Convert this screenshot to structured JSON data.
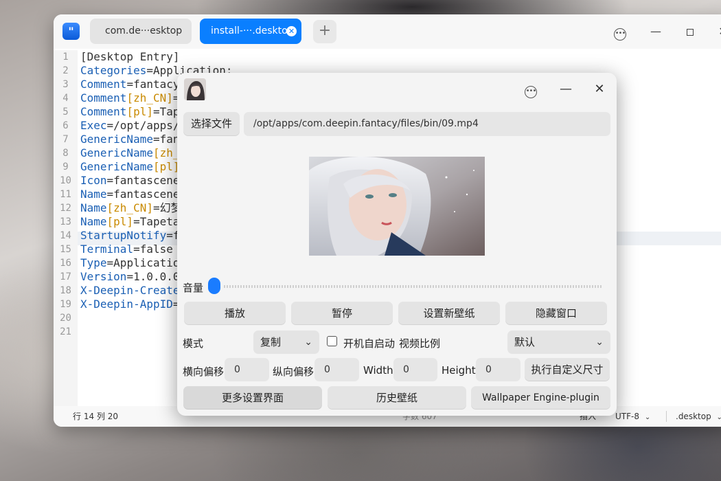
{
  "editor": {
    "tabs": [
      {
        "label": "com.de···esktop"
      },
      {
        "label": "install-···.deskto"
      }
    ],
    "tab_add_label": "+",
    "line_numbers": [
      "1",
      "2",
      "3",
      "4",
      "5",
      "6",
      "7",
      "8",
      "9",
      "10",
      "11",
      "12",
      "13",
      "14",
      "15",
      "16",
      "17",
      "18",
      "19",
      "20",
      "21"
    ],
    "lines": [
      {
        "plain": "[Desktop Entry]"
      },
      {
        "key": "Categories",
        "val": "Application;"
      },
      {
        "key": "Comment",
        "val": "fantacy"
      },
      {
        "key": "Comment",
        "loc": "[zh_CN]",
        "val": ""
      },
      {
        "key": "Comment",
        "loc": "[pl]",
        "val": "Tap"
      },
      {
        "key": "Exec",
        "val": "/opt/apps/"
      },
      {
        "key": "GenericName",
        "val": "fan"
      },
      {
        "key": "GenericName",
        "loc": "[zh_",
        "val": ""
      },
      {
        "key": "GenericName",
        "loc": "[pl]",
        "val": ""
      },
      {
        "key": "Icon",
        "val": "fantascene"
      },
      {
        "key": "Name",
        "val": "fantascene"
      },
      {
        "key": "Name",
        "loc": "[zh_CN]",
        "val": "幻梦"
      },
      {
        "key": "Name",
        "loc": "[pl]",
        "val": "Tapeta"
      },
      {
        "key": "StartupNotify",
        "val": "f"
      },
      {
        "key": "Terminal",
        "val": "false"
      },
      {
        "key": "Type",
        "val": "Applicatio"
      },
      {
        "key": "Version",
        "val": "1.0.0.0"
      },
      {
        "key": "X-Deepin-Create",
        "val": ""
      },
      {
        "key": "X-Deepin-AppID",
        "val": ""
      },
      {
        "plain": ""
      },
      {
        "plain": ""
      }
    ],
    "status": {
      "position": "行 14 列 20",
      "char_count": "字数 607",
      "insert_mode": "插入",
      "encoding": "UTF-8",
      "file_type": ".desktop"
    }
  },
  "dialog": {
    "choose_file_label": "选择文件",
    "file_path": "/opt/apps/com.deepin.fantacy/files/bin/09.mp4",
    "volume_label": "音量",
    "volume_level": 0.02,
    "buttons": {
      "play": "播放",
      "pause": "暂停",
      "set_wallpaper": "设置新壁纸",
      "hide_window": "隐藏窗口",
      "apply_custom_size": "执行自定义尺寸",
      "more_settings": "更多设置界面",
      "history": "历史壁纸",
      "plugin": "Wallpaper Engine-plugin"
    },
    "mode_label": "模式",
    "mode_value": "复制",
    "autostart_label": "开机自启动",
    "autostart_checked": false,
    "ratio_label": "视频比例",
    "ratio_value": "默认",
    "h_offset_label": "横向偏移",
    "h_offset_value": "0",
    "v_offset_label": "纵向偏移",
    "v_offset_value": "0",
    "width_label": "Width",
    "width_value": "0",
    "height_label": "Height",
    "height_value": "0"
  },
  "icons": {
    "app": "text-editor-icon",
    "menu": "more-menu-icon",
    "minimize": "minimize-icon",
    "maximize": "maximize-icon",
    "close": "close-icon",
    "chevron": "chevron-down-icon"
  },
  "colors": {
    "accent": "#0a7fff",
    "syntax_key": "#1a5fb4",
    "syntax_locale": "#c98a00"
  }
}
